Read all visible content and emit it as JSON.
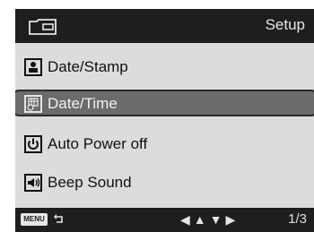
{
  "header": {
    "title": "Setup",
    "mode_icon": "camera-icon"
  },
  "menu": {
    "items": [
      {
        "label": "Date/Stamp",
        "icon": "stamp-icon",
        "selected": false
      },
      {
        "label": "Date/Time",
        "icon": "calendar-clock-icon",
        "selected": true
      },
      {
        "label": "Auto Power off",
        "icon": "power-icon",
        "selected": false
      },
      {
        "label": "Beep Sound",
        "icon": "speaker-icon",
        "selected": false
      }
    ]
  },
  "footer": {
    "menu_label": "MENU",
    "back_icon": "back-arrow-icon",
    "nav_arrows": "◀▲▼▶",
    "page": "1/3"
  },
  "colors": {
    "bar_bg": "#1e1e1e",
    "screen_bg": "#dcdcdc",
    "selected_bg": "#6b6b6b"
  }
}
